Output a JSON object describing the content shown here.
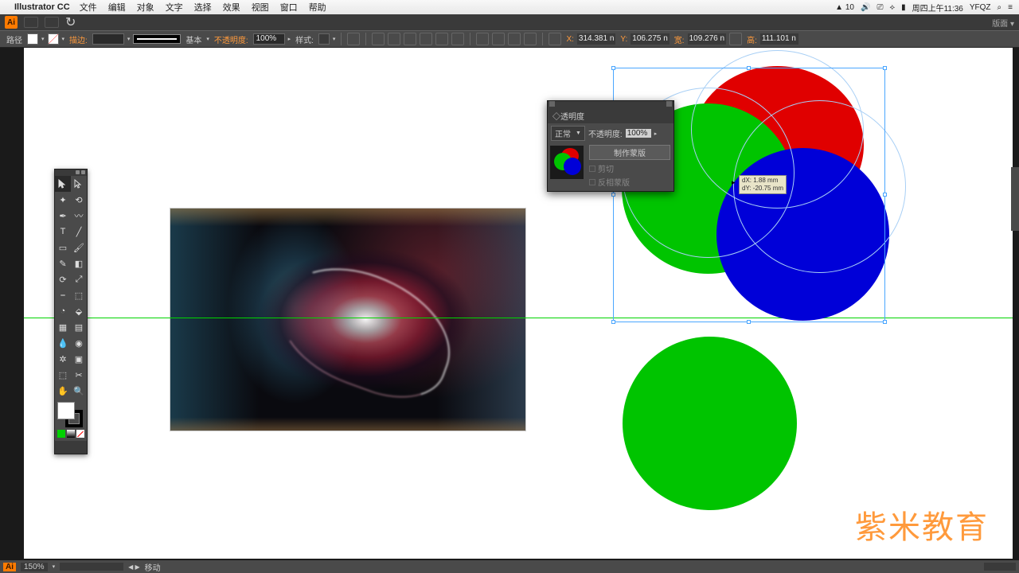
{
  "mac": {
    "app": "Illustrator CC",
    "menus": [
      "文件",
      "编辑",
      "对象",
      "文字",
      "选择",
      "效果",
      "视图",
      "窗口",
      "帮助"
    ],
    "tray_text1": "10",
    "clock": "周四上午11:36",
    "user": "YFQZ"
  },
  "titlebar": {
    "right": "版面 ▾"
  },
  "ctrlbar": {
    "path_lbl": "路径",
    "stroke_lbl": "描边:",
    "stroke_preset": "基本",
    "opacity_lbl": "不透明度:",
    "opacity_val": "100%",
    "style_lbl": "样式:",
    "x_lbl": "X:",
    "x_val": "314.381 n",
    "y_lbl": "Y:",
    "y_val": "106.275 n",
    "w_lbl": "宽:",
    "w_val": "109.276 n",
    "h_lbl": "高:",
    "h_val": "111.101 n"
  },
  "transform_tip": {
    "l1": "dX: 1.88 mm",
    "l2": "dY: -20.75 mm"
  },
  "panel": {
    "title": "◇透明度",
    "mode": "正常",
    "op_lbl": "不透明度:",
    "op_val": "100%",
    "make_mask": "制作蒙版",
    "clip": "剪切",
    "invert": "反相蒙版"
  },
  "status": {
    "zoom": "150%",
    "action": "移动",
    "ai_badge": "Ai"
  },
  "watermark": "米教育",
  "colors": {
    "red": "#e00000",
    "green": "#00c400",
    "blue": "#0000d8",
    "accent": "#ff9a3c"
  }
}
